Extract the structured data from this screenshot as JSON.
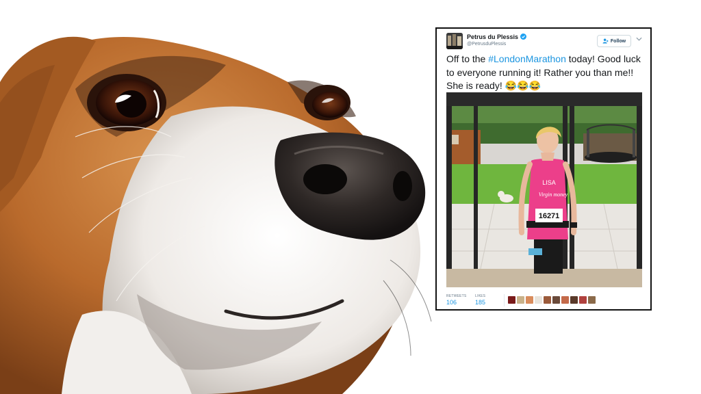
{
  "tweet": {
    "display_name": "Petrus du Plessis",
    "handle": "@PetrusduPlessis",
    "follow_label": "Follow",
    "text_before": "Off to the ",
    "hashtag": "#LondonMarathon",
    "text_after": " today! Good luck to everyone running it! Rather you than me!! She is ready! 😂😂😂",
    "photo": {
      "shirt_name": "LISA",
      "shirt_sponsor": "Virgin money",
      "bib_number": "16271"
    },
    "stats": {
      "retweets_label": "RETWEETS",
      "retweets": "106",
      "likes_label": "LIKES",
      "likes": "185"
    },
    "liker_avatar_colors": [
      "#7a1a1a",
      "#c9b28a",
      "#d98c5c",
      "#e9e4dc",
      "#9b5a3a",
      "#6a4a3a",
      "#c46a4a",
      "#5a3a2a",
      "#b0413e",
      "#8b6a4a"
    ]
  },
  "colors": {
    "link_blue": "#1b95e0",
    "verified_blue": "#1da1f2",
    "shirt_pink": "#ec3f8a"
  }
}
